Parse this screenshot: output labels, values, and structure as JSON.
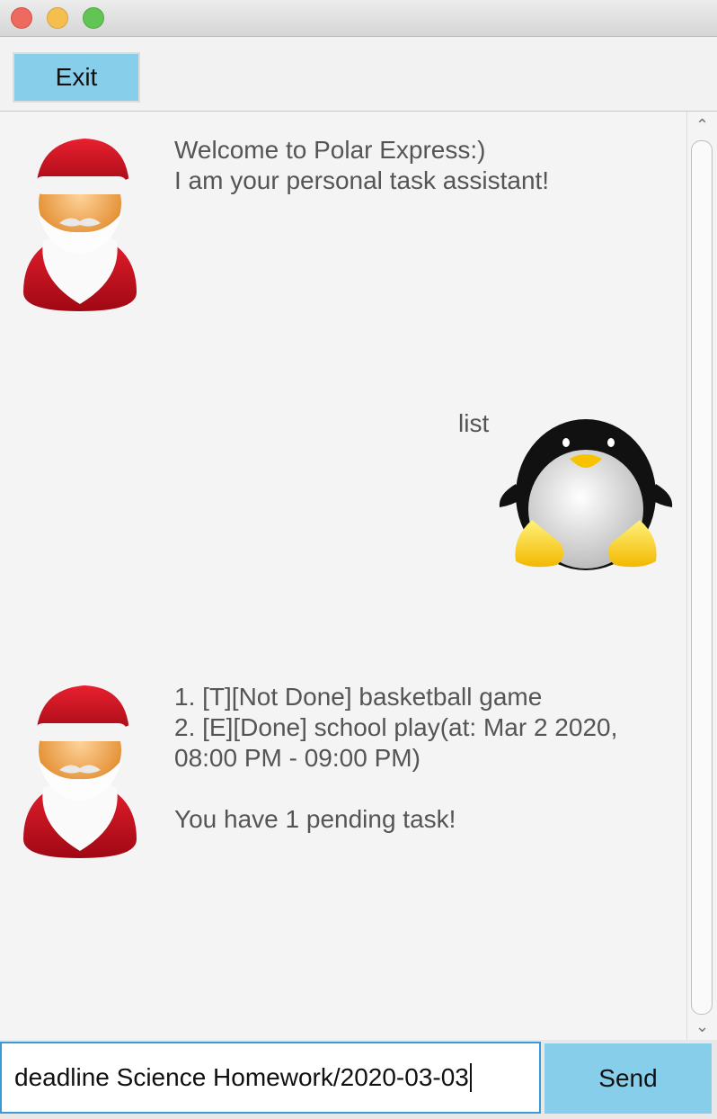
{
  "window": {
    "controls": [
      "close",
      "minimize",
      "maximize"
    ]
  },
  "toolbar": {
    "exit_label": "Exit"
  },
  "messages": [
    {
      "sender": "bot",
      "avatar": "santa-icon",
      "text": "Welcome to Polar Express:)\nI am your personal task assistant!"
    },
    {
      "sender": "user",
      "avatar": "penguin-icon",
      "text": "list"
    },
    {
      "sender": "bot",
      "avatar": "santa-icon",
      "text": "1. [T][Not Done] basketball game\n2. [E][Done] school play(at: Mar 2 2020,\n08:00 PM - 09:00 PM)\n\n You have 1 pending task!"
    }
  ],
  "input": {
    "value": "deadline Science Homework/2020-03-03"
  },
  "send_label": "Send",
  "colors": {
    "button": "#87ceeb",
    "input_focus": "#3b99d8"
  }
}
